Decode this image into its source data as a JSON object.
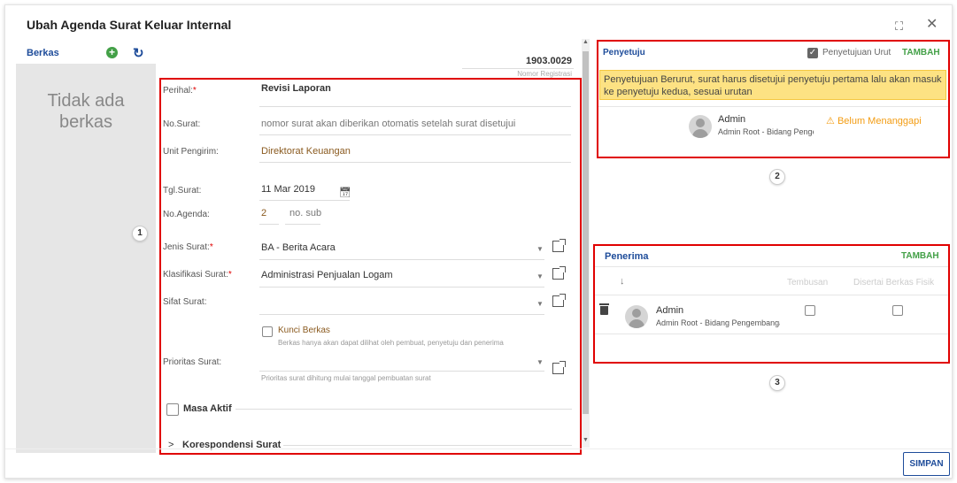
{
  "dialog": {
    "title": "Ubah Agenda Surat Keluar Internal",
    "expand_icon": "⛶",
    "close_icon": "✕"
  },
  "berkas": {
    "label": "Berkas",
    "add_icon": "+",
    "refresh_icon": "↻",
    "empty_text_1": "Tidak ada",
    "empty_text_2": "berkas"
  },
  "registrasi": {
    "number": "1903.0029",
    "caption": "Nomor Registrasi"
  },
  "form": {
    "perihal_label": "Perihal:",
    "perihal_value": "Revisi Laporan",
    "nosurat_label": "No.Surat:",
    "nosurat_value": "nomor surat akan diberikan otomatis setelah surat disetujui",
    "unit_label": "Unit Pengirim:",
    "unit_value": "Direktorat Keuangan",
    "tgl_label": "Tgl.Surat:",
    "tgl_value": "11 Mar 2019",
    "agenda_label": "No.Agenda:",
    "agenda_value": "2",
    "agenda_sub": "no. sub",
    "jenis_label": "Jenis Surat:",
    "jenis_value": "BA - Berita Acara",
    "klasifikasi_label": "Klasifikasi Surat:",
    "klasifikasi_value": "Administrasi Penjualan Logam",
    "sifat_label": "Sifat Surat:",
    "sifat_value": "",
    "kunci_label": "Kunci Berkas",
    "kunci_hint": "Berkas hanya akan dapat dilihat oleh pembuat, penyetuju dan penerima",
    "prioritas_label": "Prioritas Surat:",
    "prioritas_hint": "Prioritas surat dihitung mulai tanggal pembuatan surat",
    "masa_aktif_label": "Masa Aktif",
    "korespondensi_label": "Korespondensi Surat",
    "korespondensi_icon": ">"
  },
  "penyetuju": {
    "title": "Penyetuju",
    "urut_label": "Penyetujuan Urut",
    "urut_checked": true,
    "tambah_label": "TAMBAH",
    "notice": "Penyetujuan Berurut, surat harus disetujui penyetuju pertama lalu akan masuk ke penyetuju kedua, sesuai urutan",
    "user_name": "Admin",
    "user_sub": "Admin Root - Bidang Pengembangan",
    "status": "Belum Menanggapi",
    "status_icon": "⚠"
  },
  "penerima": {
    "title": "Penerima",
    "tambah_label": "TAMBAH",
    "sort_icon": "↓",
    "col_tembusan": "Tembusan",
    "col_fisik": "Disertai Berkas Fisik",
    "user_name": "Admin",
    "user_sub": "Admin Root - Bidang Pengembangan"
  },
  "badges": {
    "one": "1",
    "two": "2",
    "three": "3"
  },
  "footer": {
    "simpan_label": "SIMPAN"
  },
  "colors": {
    "brand_blue": "#1e4c9a",
    "tambah_green": "#43a047",
    "highlight_red": "#e00000",
    "notice_yellow": "#fde283",
    "warn_orange": "#f39c12"
  }
}
